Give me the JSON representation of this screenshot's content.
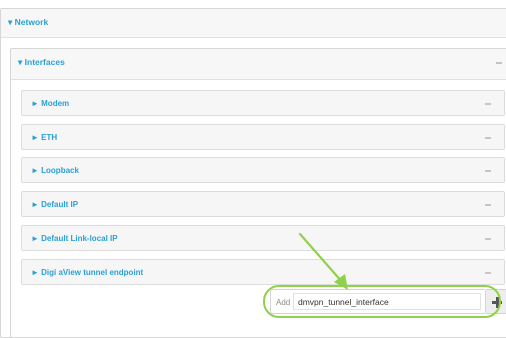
{
  "network": {
    "title": "Network"
  },
  "interfaces": {
    "title": "Interfaces",
    "items": [
      {
        "label": "Modem"
      },
      {
        "label": "ETH"
      },
      {
        "label": "Loopback"
      },
      {
        "label": "Default IP"
      },
      {
        "label": "Default Link-local IP"
      },
      {
        "label": "Digi aView tunnel endpoint"
      }
    ]
  },
  "add_form": {
    "label": "Add",
    "value": "dmvpn_tunnel_interface"
  },
  "colors": {
    "link": "#2aa0d4",
    "highlight": "#8fd14a"
  }
}
